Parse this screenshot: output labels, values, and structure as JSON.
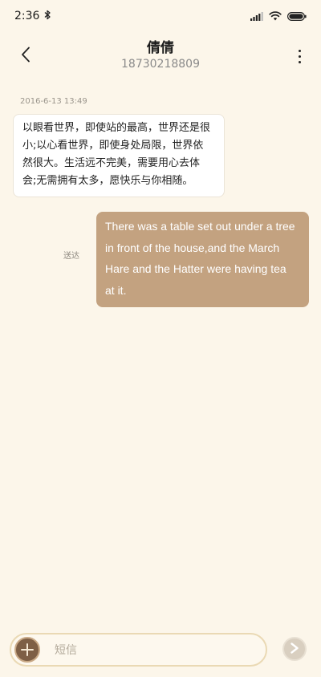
{
  "status_bar": {
    "time": "2:36",
    "icons": [
      "bluetooth-icon",
      "signal-icon",
      "wifi-icon",
      "battery-icon"
    ]
  },
  "header": {
    "contact_name": "倩倩",
    "contact_number": "18730218809",
    "back_icon": "chevron-left-icon",
    "menu_icon": "more-vertical-icon"
  },
  "messages": [
    {
      "direction": "incoming",
      "timestamp": "2016-6-13 13:49",
      "lines": [
        "以眼看世界，即使站的最高，世界还是很",
        "小;以心看世界，即使身处局限，世界依",
        "然很大。生活远不完美，需要用心去体",
        "会;无需拥有太多，愿快乐与你相随。"
      ]
    },
    {
      "direction": "outgoing",
      "status": "送达",
      "lines": [
        "There was a table set out under a tree",
        "in front of the house,and the March",
        "Hare and the Hatter were having tea",
        "at it."
      ]
    }
  ],
  "composer": {
    "placeholder": "短信",
    "value": "",
    "add_icon": "plus-icon",
    "send_icon": "send-arrow-icon"
  },
  "colors": {
    "background": "#fcf6ea",
    "outgoing_bubble": "#c3a280",
    "incoming_bubble": "#ffffff",
    "accent_brown": "#7e5f45"
  }
}
